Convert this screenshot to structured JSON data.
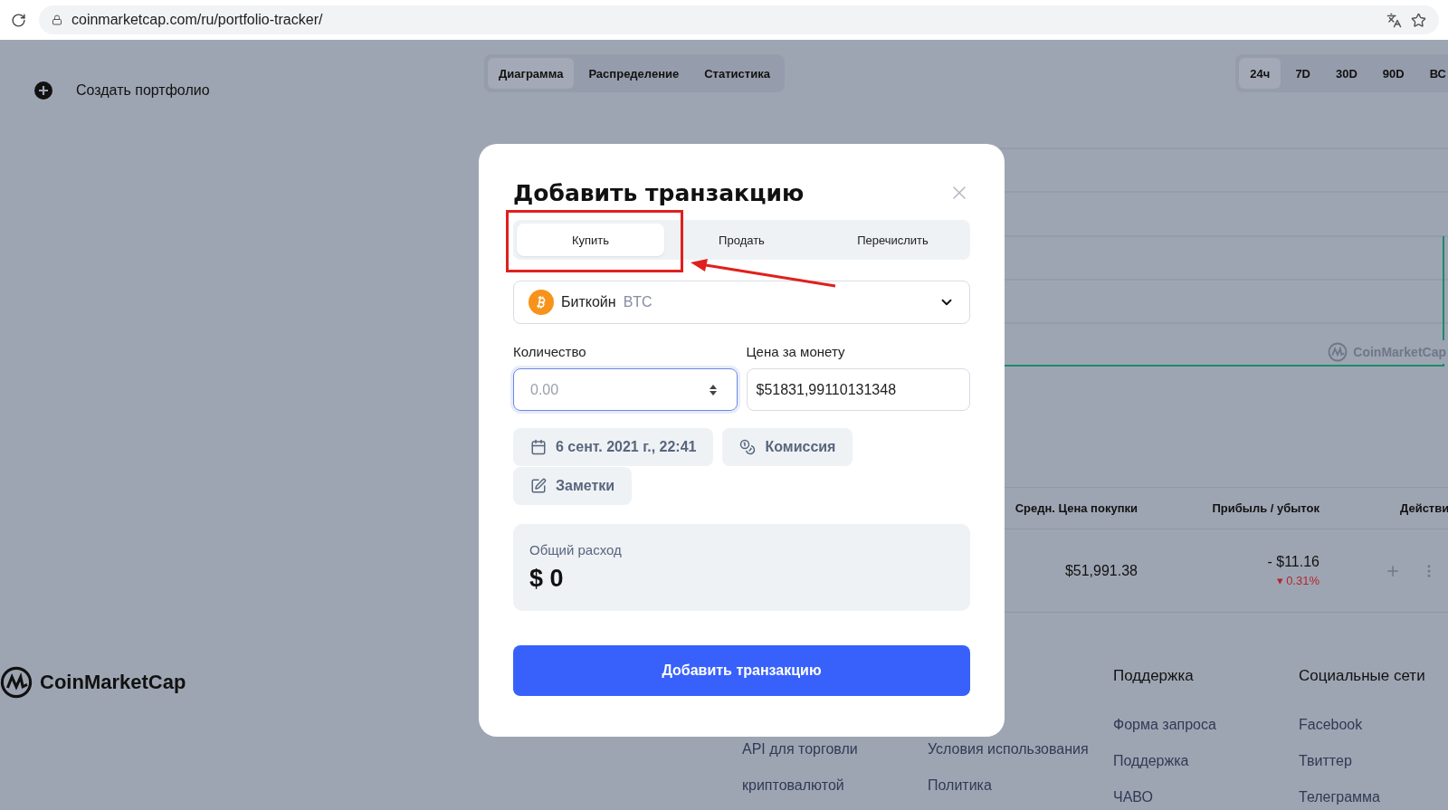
{
  "browser": {
    "url": "coinmarketcap.com/ru/portfolio-tracker/"
  },
  "sidebar": {
    "create_button": "Создать портфолио"
  },
  "view_tabs": [
    {
      "label": "Диаграмма",
      "selected": true
    },
    {
      "label": "Распределение",
      "selected": false
    },
    {
      "label": "Статистика",
      "selected": false
    }
  ],
  "range_tabs": [
    {
      "label": "24ч",
      "selected": true
    },
    {
      "label": "7D",
      "selected": false
    },
    {
      "label": "30D",
      "selected": false
    },
    {
      "label": "90D",
      "selected": false
    },
    {
      "label": "ВС",
      "selected": false
    }
  ],
  "chart": {
    "watermark": "CoinMarketCap"
  },
  "table": {
    "columns": [
      "Средн. Цена покупки",
      "Прибыль / убыток",
      "Действи"
    ],
    "rows": [
      {
        "avg_price": "$51,991.38",
        "profit": "- $11.16",
        "change": "0.31%",
        "caret": "▾"
      }
    ]
  },
  "footer": {
    "logo": "CoinMarketCap",
    "columns": [
      {
        "items": [
          "API для торговли",
          "криптовалютой"
        ]
      },
      {
        "items": [
          "Условия использования",
          "Политика"
        ]
      },
      {
        "heading": "Поддержка",
        "items": [
          "Форма запроса",
          "Поддержка",
          "ЧАВО"
        ]
      },
      {
        "heading": "Социальные сети",
        "items": [
          "Facebook",
          "Твиттер",
          "Телеграмма"
        ]
      }
    ]
  },
  "modal": {
    "title": "Добавить транзакцию",
    "tabs": [
      {
        "label": "Купить",
        "selected": true
      },
      {
        "label": "Продать",
        "selected": false
      },
      {
        "label": "Перечислить",
        "selected": false
      }
    ],
    "coin": {
      "name": "Биткойн",
      "symbol": "BTC"
    },
    "quantity": {
      "label": "Количество",
      "placeholder": "0.00",
      "focused": true
    },
    "price": {
      "label": "Цена за монету",
      "value": "$51831,99110131348"
    },
    "date_button": "6 сент. 2021 г., 22:41",
    "fee_button": "Комиссия",
    "notes_button": "Заметки",
    "total": {
      "label": "Общий расход",
      "value": "$ 0"
    },
    "submit": "Добавить транзакцию"
  }
}
